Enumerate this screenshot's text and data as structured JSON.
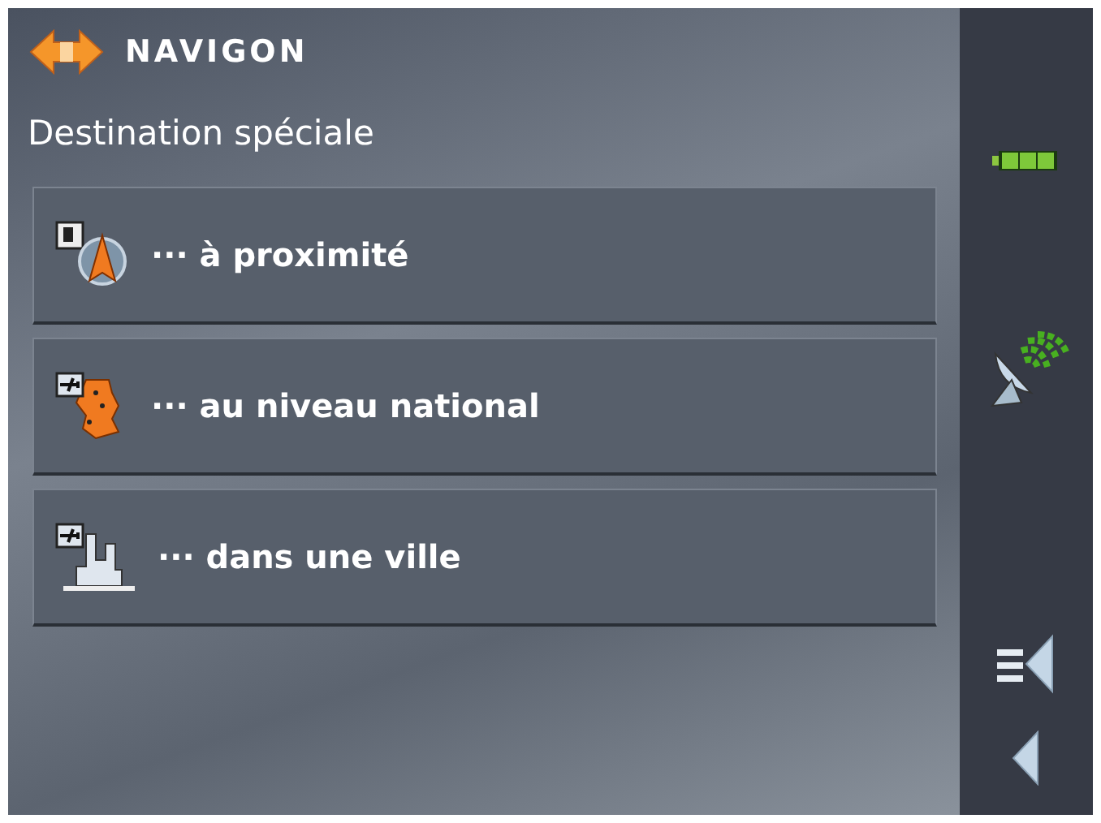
{
  "brand": {
    "name": "NAVIGON"
  },
  "title": "Destination spéciale",
  "menu": [
    {
      "kind": "nearby",
      "label": "··· à proximité"
    },
    {
      "kind": "national",
      "label": "··· au niveau national"
    },
    {
      "kind": "city",
      "label": "··· dans une ville"
    }
  ]
}
